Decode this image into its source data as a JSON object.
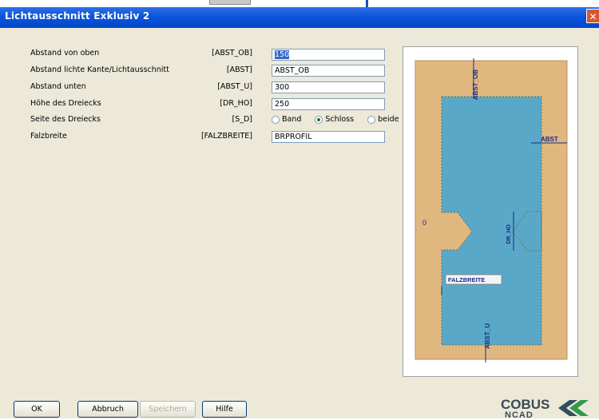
{
  "window": {
    "title": "Lichtausschnitt Exklusiv 2",
    "close_glyph": "✕"
  },
  "params": [
    {
      "label": "Abstand von oben",
      "var": "[ABST_OB]",
      "value": "150",
      "selected": true
    },
    {
      "label": "Abstand lichte Kante/Lichtausschnitt",
      "var": "[ABST]",
      "value": "ABST_OB"
    },
    {
      "label": "Abstand unten",
      "var": "[ABST_U]",
      "value": "300"
    },
    {
      "label": "Höhe des Dreiecks",
      "var": "[DR_HO]",
      "value": "250"
    },
    {
      "label": "Seite des Dreiecks",
      "var": "[S_D]"
    },
    {
      "label": "Falzbreite",
      "var": "[FALZBREITE]",
      "value": "BRPROFIL"
    }
  ],
  "side_options": [
    {
      "label": "Band",
      "checked": false
    },
    {
      "label": "Schloss",
      "checked": true
    },
    {
      "label": "beide",
      "checked": false
    }
  ],
  "preview": {
    "labels": {
      "abst_ob": "ABST_OB",
      "abst": "ABST",
      "dr_ho": "DR_HO",
      "falzbreite": "FALZBREITE",
      "abst_u": "ABST_U",
      "zero": "0"
    },
    "colors": {
      "frame": "#e1b780",
      "glass": "#5aa8c8",
      "dim": "#1a2a8a"
    }
  },
  "buttons": {
    "ok": "OK",
    "abbruch": "Abbruch",
    "speichern": "Speichern",
    "hilfe": "Hilfe"
  },
  "logo": {
    "brand": "COBUS",
    "sub": "NCAD",
    "icon": "cobus-chevron-logo"
  }
}
